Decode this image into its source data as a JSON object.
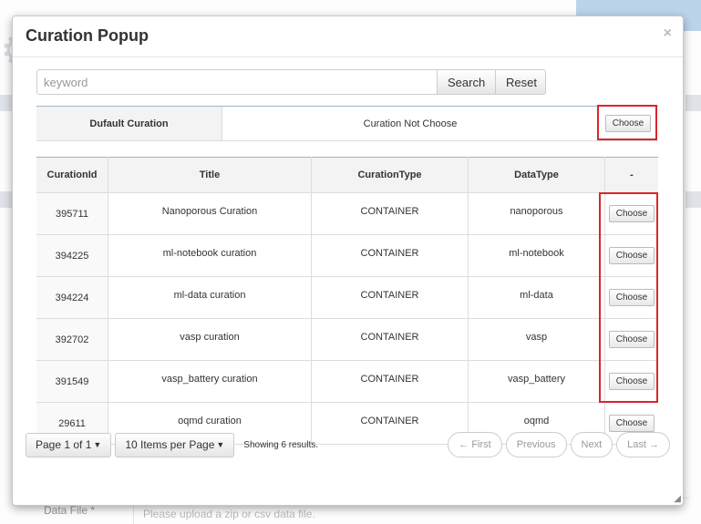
{
  "background": {
    "footer_label": "Data File *",
    "footer_placeholder": "Please upload a zip or csv data file."
  },
  "modal": {
    "title": "Curation Popup",
    "close": "×"
  },
  "search": {
    "placeholder": "keyword",
    "value": "",
    "search_label": "Search",
    "reset_label": "Reset"
  },
  "default_curation": {
    "label": "Dufault Curation",
    "value": "Curation Not Choose",
    "choose_label": "Choose"
  },
  "table": {
    "headers": [
      "CurationId",
      "Title",
      "CurationType",
      "DataType",
      "-"
    ],
    "rows": [
      {
        "id": "395711",
        "title": "Nanoporous Curation",
        "type": "CONTAINER",
        "datatype": "nanoporous",
        "action": "Choose"
      },
      {
        "id": "394225",
        "title": "ml-notebook curation",
        "type": "CONTAINER",
        "datatype": "ml-notebook",
        "action": "Choose"
      },
      {
        "id": "394224",
        "title": "ml-data curation",
        "type": "CONTAINER",
        "datatype": "ml-data",
        "action": "Choose"
      },
      {
        "id": "392702",
        "title": "vasp curation",
        "type": "CONTAINER",
        "datatype": "vasp",
        "action": "Choose"
      },
      {
        "id": "391549",
        "title": "vasp_battery curation",
        "type": "CONTAINER",
        "datatype": "vasp_battery",
        "action": "Choose"
      },
      {
        "id": "29611",
        "title": "oqmd curation",
        "type": "CONTAINER",
        "datatype": "oqmd",
        "action": "Choose"
      }
    ]
  },
  "pagination": {
    "page_label": "Page 1 of 1",
    "per_page_label": "10 Items per Page",
    "showing": "Showing 6 results.",
    "first": "← First",
    "previous": "Previous",
    "next": "Next",
    "last": "Last →"
  },
  "colors": {
    "highlight": "#d9262c",
    "header_rule": "#9fb3c8"
  }
}
